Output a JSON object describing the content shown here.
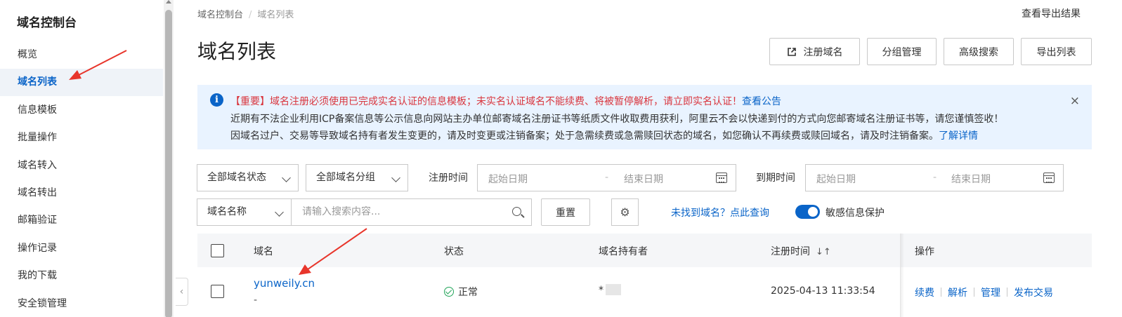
{
  "sidebar": {
    "title": "域名控制台",
    "items": [
      {
        "label": "概览"
      },
      {
        "label": "域名列表"
      },
      {
        "label": "信息模板"
      },
      {
        "label": "批量操作"
      },
      {
        "label": "域名转入"
      },
      {
        "label": "域名转出"
      },
      {
        "label": "邮箱验证"
      },
      {
        "label": "操作记录"
      },
      {
        "label": "我的下载"
      },
      {
        "label": "安全锁管理"
      }
    ]
  },
  "breadcrumb": {
    "root": "域名控制台",
    "sep": "/",
    "current": "域名列表"
  },
  "header": {
    "export_results": "查看导出结果",
    "title": "域名列表"
  },
  "actions": {
    "register": "注册域名",
    "group_manage": "分组管理",
    "advanced_search": "高级搜索",
    "export_list": "导出列表"
  },
  "notice": {
    "line1": "【重要】域名注册必须使用已完成实名认证的信息模板；未实名认证域名不能续费、将被暂停解析，请立即实名认证！",
    "line1_link": "查看公告",
    "line2": "近期有不法企业利用ICP备案信息等公示信息向网站主办单位邮寄域名注册证书等纸质文件收取费用获利，阿里云不会以快递到付的方式向您邮寄域名注册证书等，请您谨慎签收！",
    "line3": "因域名过户、交易等导致域名持有者发生变更的，请及时变更或注销备案；处于急需续费或急需赎回状态的域名，如您确认不再续费或赎回域名，请及时注销备案。",
    "line3_link": "了解详情",
    "close": "×"
  },
  "filters": {
    "status": "全部域名状态",
    "group": "全部域名分组",
    "reg_time_label": "注册时间",
    "reg_start": "起始日期",
    "reg_end": "结束日期",
    "exp_time_label": "到期时间",
    "exp_start": "起始日期",
    "exp_end": "结束日期",
    "dash": "-",
    "search_field": "域名名称",
    "search_placeholder": "请输入搜索内容...",
    "reset": "重置",
    "not_found": "未找到域名？点此查询",
    "sensitive_protect": "敏感信息保护"
  },
  "table": {
    "headers": {
      "domain": "域名",
      "status": "状态",
      "holder": "域名持有者",
      "reg_time": "注册时间",
      "ops": "操作"
    },
    "rows": [
      {
        "domain": "yunweily.cn",
        "sub": "-",
        "status": "正常",
        "holder": "*",
        "reg_time": "2025-04-13 11:33:54",
        "ops": [
          "续费",
          "解析",
          "管理",
          "发布交易"
        ]
      }
    ]
  },
  "colors": {
    "accent": "#0a64c8",
    "warning": "#d9363e",
    "ok": "#23a55a",
    "annotation_arrow": "#e8352b"
  }
}
